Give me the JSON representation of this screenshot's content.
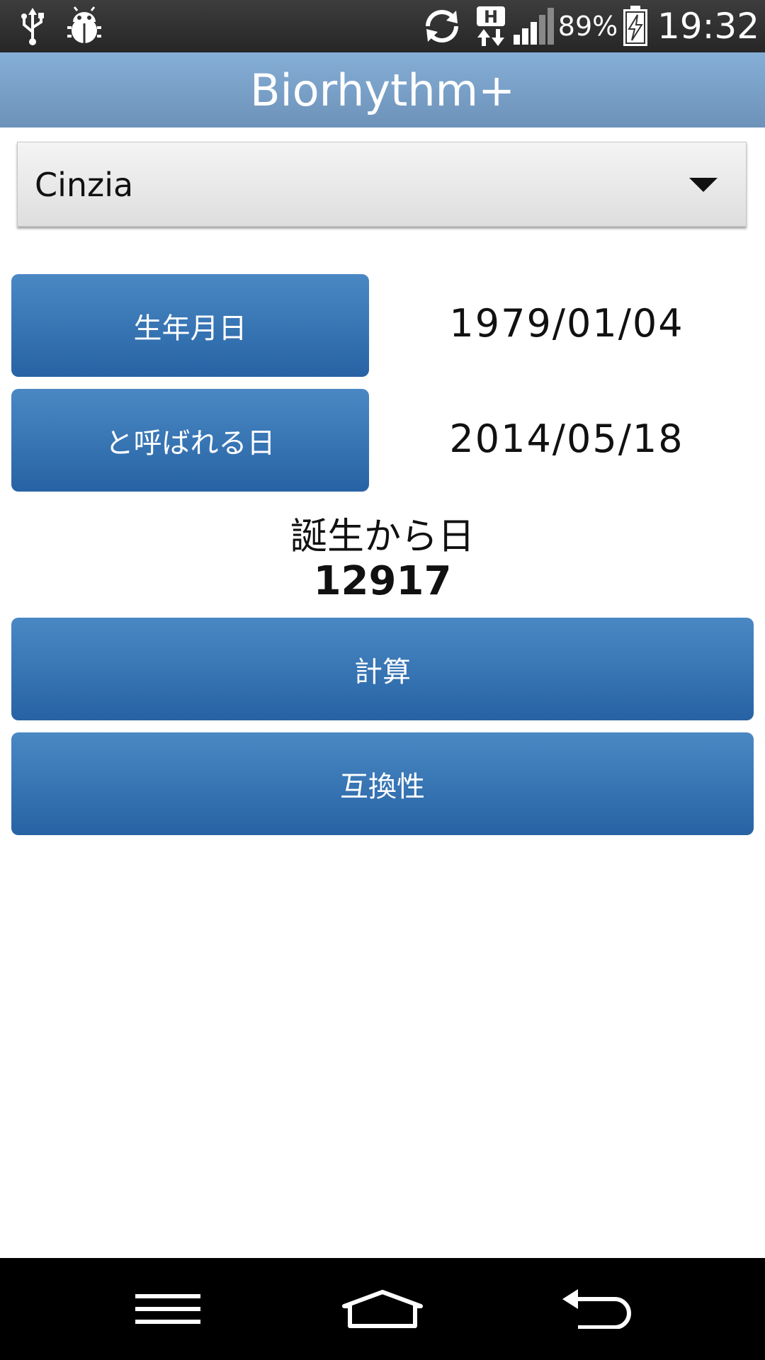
{
  "status_bar": {
    "icons": [
      "usb-icon",
      "debug-bug-icon",
      "sync-icon",
      "hspa-data-icon",
      "signal-icon",
      "battery-charging-icon"
    ],
    "battery_percent": "89%",
    "time": "19:32"
  },
  "action_bar": {
    "title": "Biorhythm+"
  },
  "profile_spinner": {
    "selected": "Cinzia"
  },
  "birth_date": {
    "button_label": "生年月日",
    "value": "1979/01/04"
  },
  "target_date": {
    "button_label": "と呼ばれる日",
    "value": "2014/05/18"
  },
  "days_since_birth": {
    "label": "誕生から日",
    "value": "12917"
  },
  "actions": {
    "calculate_label": "計算",
    "compatibility_label": "互換性"
  },
  "nav_bar": {
    "icons": [
      "menu-icon",
      "home-icon",
      "back-icon"
    ]
  },
  "colors": {
    "action_bar": "#7aa2cb",
    "button": "#3a78b8",
    "status_bar": "#333333",
    "nav_bar": "#000000"
  }
}
